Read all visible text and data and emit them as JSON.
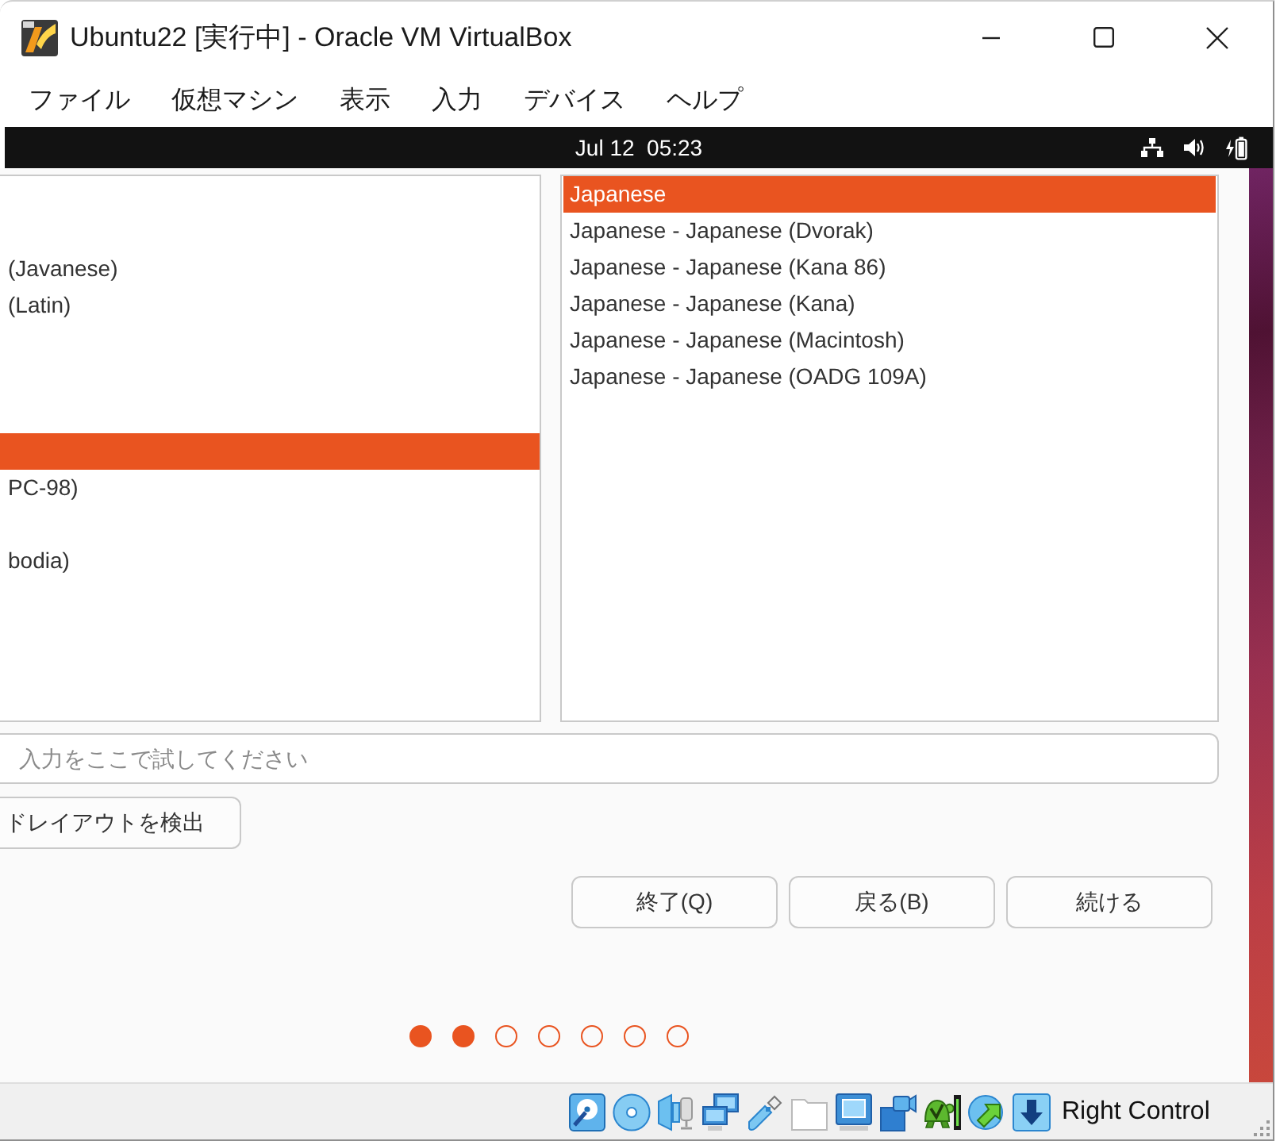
{
  "window": {
    "title": "Ubuntu22 [実行中] - Oracle VM VirtualBox"
  },
  "menu": [
    "ファイル",
    "仮想マシン",
    "表示",
    "入力",
    "デバイス",
    "ヘルプ"
  ],
  "guest_top_bar": {
    "clock": "Jul 12  05:23"
  },
  "installer": {
    "layout_list": {
      "items": [
        {
          "selected": false
        },
        {
          "selected": false
        },
        {
          "label": "(Javanese)",
          "selected": false
        },
        {
          "label": "(Latin)",
          "selected": false
        },
        {
          "selected": false
        },
        {
          "selected": false
        },
        {
          "selected": false
        },
        {
          "selected": true
        },
        {
          "label": "PC-98)",
          "selected": false
        },
        {
          "selected": false
        },
        {
          "label": "bodia)",
          "selected": false
        }
      ]
    },
    "variant_list": {
      "items": [
        {
          "label": "Japanese",
          "selected": true
        },
        {
          "label": "Japanese - Japanese (Dvorak)",
          "selected": false
        },
        {
          "label": "Japanese - Japanese (Kana 86)",
          "selected": false
        },
        {
          "label": "Japanese - Japanese (Kana)",
          "selected": false
        },
        {
          "label": "Japanese - Japanese (Macintosh)",
          "selected": false
        },
        {
          "label": "Japanese - Japanese (OADG 109A)",
          "selected": false
        }
      ]
    },
    "test_field": {
      "placeholder": "入力をここで試してください"
    },
    "detect_button": "ドレイアウトを検出",
    "buttons": [
      "終了(Q)",
      "戻る(B)",
      "続ける"
    ],
    "steps": [
      {
        "filled": true
      },
      {
        "filled": true
      },
      {
        "filled": false
      },
      {
        "filled": false
      },
      {
        "filled": false
      },
      {
        "filled": false
      },
      {
        "filled": false
      }
    ]
  },
  "status_bar": {
    "icons": [
      {
        "kind": "disk",
        "disabled": false
      },
      {
        "kind": "optical",
        "disabled": false
      },
      {
        "kind": "audio",
        "disabled": false
      },
      {
        "kind": "network",
        "disabled": false
      },
      {
        "kind": "usb",
        "disabled": false
      },
      {
        "kind": "folders",
        "disabled": true
      },
      {
        "kind": "display",
        "disabled": false
      },
      {
        "kind": "capture",
        "disabled": false
      },
      {
        "kind": "engine",
        "disabled": false
      },
      {
        "kind": "mouse",
        "disabled": false
      },
      {
        "kind": "keyboard",
        "disabled": false
      }
    ],
    "host_key": "Right Control"
  }
}
